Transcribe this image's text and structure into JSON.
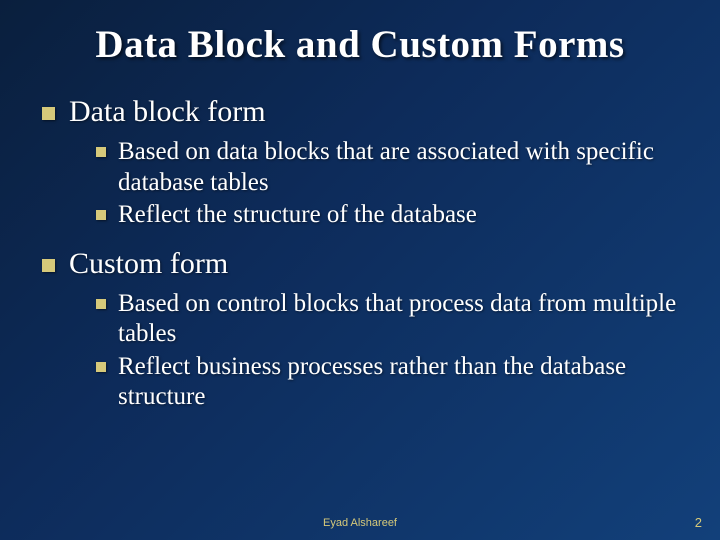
{
  "title": "Data Block and Custom Forms",
  "sections": [
    {
      "heading": "Data block form",
      "items": [
        "Based on data blocks that are associated with specific database tables",
        "Reflect the structure of the database"
      ]
    },
    {
      "heading": "Custom form",
      "items": [
        "Based on control blocks that process data from multiple tables",
        "Reflect business processes rather than the database structure"
      ]
    }
  ],
  "footer": {
    "author": "Eyad Alshareef",
    "page": "2"
  }
}
